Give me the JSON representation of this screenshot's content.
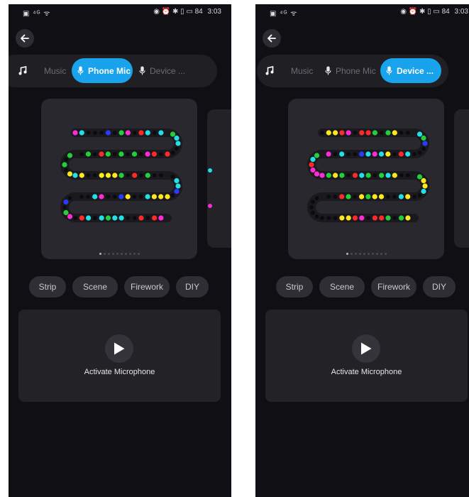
{
  "status_bar": {
    "left_icons": "▣ ⁴ᴳ ᯤ",
    "right_icons": "◉ ⏰ ✱ ▯ ▭",
    "battery": "84",
    "time": "3:03"
  },
  "mode_tabs": [
    {
      "label": "Music",
      "icon": "music-note-icon"
    },
    {
      "label": "Phone Mic",
      "icon": "microphone-icon"
    },
    {
      "label": "Device ...",
      "icon": "microphone-icon"
    }
  ],
  "effect_tabs": [
    "Strip",
    "Scene",
    "Firework",
    "DIY"
  ],
  "activate_label": "Activate Microphone",
  "screens": [
    {
      "active_mode": 1,
      "active_effect": 0,
      "page_dots": 10,
      "active_dot": 0
    },
    {
      "active_mode": 2,
      "active_effect": 0,
      "page_dots": 10,
      "active_dot": 0
    }
  ],
  "colors": {
    "accent": "#19a3ec",
    "led_off": "#0b0b0d",
    "led_palette": [
      "#ff2bd6",
      "#22e0e6",
      "#22d13a",
      "#ff2a2a",
      "#ffe81e",
      "#2a3bff"
    ]
  },
  "led_patterns": [
    "mc000b0gm0rc0cgcc00r0rm0g0g0gr0g0g0g0ycy00yyyg0r0g000ccb0yyyc00yb00",
    "0yyrm0rrg0gy00cgb000cr0ycmcb00c0mgcrmmmgyg0rcg0gcy00gyyc00yc00yygy0gr000000000"
  ]
}
